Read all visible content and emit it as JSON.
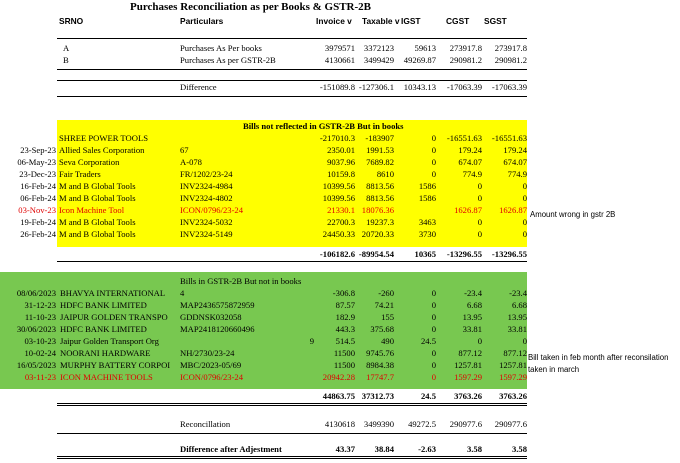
{
  "title": "Purchases Reconciliation as per Books & GSTR-2B",
  "headers": [
    "SRNO",
    "Particulars",
    "Invoice v",
    "Taxable v",
    "IGST",
    "CGST",
    "SGST"
  ],
  "summary_rows": [
    {
      "srno": "A",
      "particulars": "Purchases As Per books",
      "invoice": "3979571",
      "taxable": "3372123",
      "igst": "59613",
      "cgst": "273917.8",
      "sgst": "273917.8"
    },
    {
      "srno": "B",
      "particulars": "Purchases As per GSTR-2B",
      "invoice": "4130661",
      "taxable": "3499429",
      "igst": "49269.87",
      "cgst": "290981.2",
      "sgst": "290981.2"
    }
  ],
  "difference": {
    "label": "Difference",
    "invoice": "-151089.8",
    "taxable": "-127306.1",
    "igst": "10343.13",
    "cgst": "-17063.39",
    "sgst": "-17063.39"
  },
  "section1": {
    "title": "Bills not reflected in GSTR-2B But in books",
    "head_row": {
      "date": "",
      "party": "SHREE POWER TOOLS",
      "invno": "",
      "invoice": "-217010.3",
      "taxable": "-183907",
      "igst": "0",
      "cgst": "-16551.63",
      "sgst": "-16551.63"
    },
    "rows": [
      {
        "date": "23-Sep-23",
        "party": "Allied Sales Corporation",
        "invno": "67",
        "invoice": "2350.01",
        "taxable": "1991.53",
        "igst": "0",
        "cgst": "179.24",
        "sgst": "179.24",
        "red": false
      },
      {
        "date": "06-May-23",
        "party": "Seva Corporation",
        "invno": "A-078",
        "invoice": "9037.96",
        "taxable": "7689.82",
        "igst": "0",
        "cgst": "674.07",
        "sgst": "674.07",
        "red": false
      },
      {
        "date": "23-Dec-23",
        "party": "Fair Traders",
        "invno": "FR/1202/23-24",
        "invoice": "10159.8",
        "taxable": "8610",
        "igst": "0",
        "cgst": "774.9",
        "sgst": "774.9",
        "red": false
      },
      {
        "date": "16-Feb-24",
        "party": "M and B Global Tools",
        "invno": "INV2324-4984",
        "invoice": "10399.56",
        "taxable": "8813.56",
        "igst": "1586",
        "cgst": "0",
        "sgst": "0",
        "red": false
      },
      {
        "date": "06-Feb-24",
        "party": "M and B Global Tools",
        "invno": "INV2324-4802",
        "invoice": "10399.56",
        "taxable": "8813.56",
        "igst": "1586",
        "cgst": "0",
        "sgst": "0",
        "red": false
      },
      {
        "date": "03-Nov-23",
        "party": "Icon Machine Tool",
        "invno": "ICON/0796/23-24",
        "invoice": "21330.1",
        "taxable": "18076.36",
        "igst": "",
        "cgst": "1626.87",
        "sgst": "1626.87",
        "red": true
      },
      {
        "date": "19-Feb-24",
        "party": "M and B Global Tools",
        "invno": "INV2324-5032",
        "invoice": "22700.3",
        "taxable": "19237.3",
        "igst": "3463",
        "cgst": "0",
        "sgst": "0",
        "red": false
      },
      {
        "date": "26-Feb-24",
        "party": "M and B Global Tools",
        "invno": "INV2324-5149",
        "invoice": "24450.33",
        "taxable": "20720.33",
        "igst": "3730",
        "cgst": "0",
        "sgst": "0",
        "red": false
      }
    ],
    "note": "Amount wrong in gstr 2B",
    "total": {
      "invoice": "-106182.6",
      "taxable": "-89954.54",
      "igst": "10365",
      "cgst": "-13296.55",
      "sgst": "-13296.55"
    }
  },
  "section2": {
    "title": "Bills in GSTR-2B But not in books",
    "rows": [
      {
        "date": "08/06/2023",
        "party": "BHAVYA INTERNATIONAL",
        "invno": "4",
        "extra": "",
        "invoice": "-306.8",
        "taxable": "-260",
        "igst": "0",
        "cgst": "-23.4",
        "sgst": "-23.4",
        "red": false
      },
      {
        "date": "31-12-23",
        "party": "HDFC BANK LIMITED",
        "invno": "MAP2436575872959",
        "extra": "",
        "invoice": "87.57",
        "taxable": "74.21",
        "igst": "0",
        "cgst": "6.68",
        "sgst": "6.68",
        "red": false
      },
      {
        "date": "11-10-23",
        "party": "JAIPUR GOLDEN TRANSPO",
        "invno": "GDDNSK032058",
        "extra": "",
        "invoice": "182.9",
        "taxable": "155",
        "igst": "0",
        "cgst": "13.95",
        "sgst": "13.95",
        "red": false
      },
      {
        "date": "30/06/2023",
        "party": "HDFC BANK LIMITED",
        "invno": "MAP2418120660496",
        "extra": "",
        "invoice": "443.3",
        "taxable": "375.68",
        "igst": "0",
        "cgst": "33.81",
        "sgst": "33.81",
        "red": false
      },
      {
        "date": "03-10-23",
        "party": "Jaipur Golden Transport Org",
        "invno": "",
        "extra": "9",
        "invoice": "514.5",
        "taxable": "490",
        "igst": "24.5",
        "cgst": "0",
        "sgst": "0",
        "red": false
      },
      {
        "date": "10-02-24",
        "party": "NOORANI HARDWARE",
        "invno": "NH/2730/23-24",
        "extra": "",
        "invoice": "11500",
        "taxable": "9745.76",
        "igst": "0",
        "cgst": "877.12",
        "sgst": "877.12",
        "red": false
      },
      {
        "date": "16/05/2023",
        "party": "MURPHY BATTERY CORPOI",
        "invno": "MBC/2023-05/69",
        "extra": "",
        "invoice": "11500",
        "taxable": "8984.38",
        "igst": "0",
        "cgst": "1257.81",
        "sgst": "1257.81",
        "red": false
      },
      {
        "date": "03-11-23",
        "party": "ICON MACHINE TOOLS",
        "invno": "ICON/0796/23-24",
        "extra": "",
        "invoice": "20942.28",
        "taxable": "17747.7",
        "igst": "0",
        "cgst": "1597.29",
        "sgst": "1597.29",
        "red": true
      }
    ],
    "notes": [
      "Bill taken in feb month after reconsilation",
      "taken in march"
    ],
    "total": {
      "invoice": "44863.75",
      "taxable": "37312.73",
      "igst": "24.5",
      "cgst": "3763.26",
      "sgst": "3763.26"
    }
  },
  "reconciliation": {
    "label": "Reconcillation",
    "invoice": "4130618",
    "taxable": "3499390",
    "igst": "49272.5",
    "cgst": "290977.6",
    "sgst": "290977.6"
  },
  "final_difference": {
    "label": "Difference after Adjestment",
    "invoice": "43.37",
    "taxable": "38.84",
    "igst": "-2.63",
    "cgst": "3.58",
    "sgst": "3.58"
  },
  "colors": {
    "yellow_band": "#ffff00",
    "green_band": "#78c850",
    "red_text": "#e00000"
  }
}
